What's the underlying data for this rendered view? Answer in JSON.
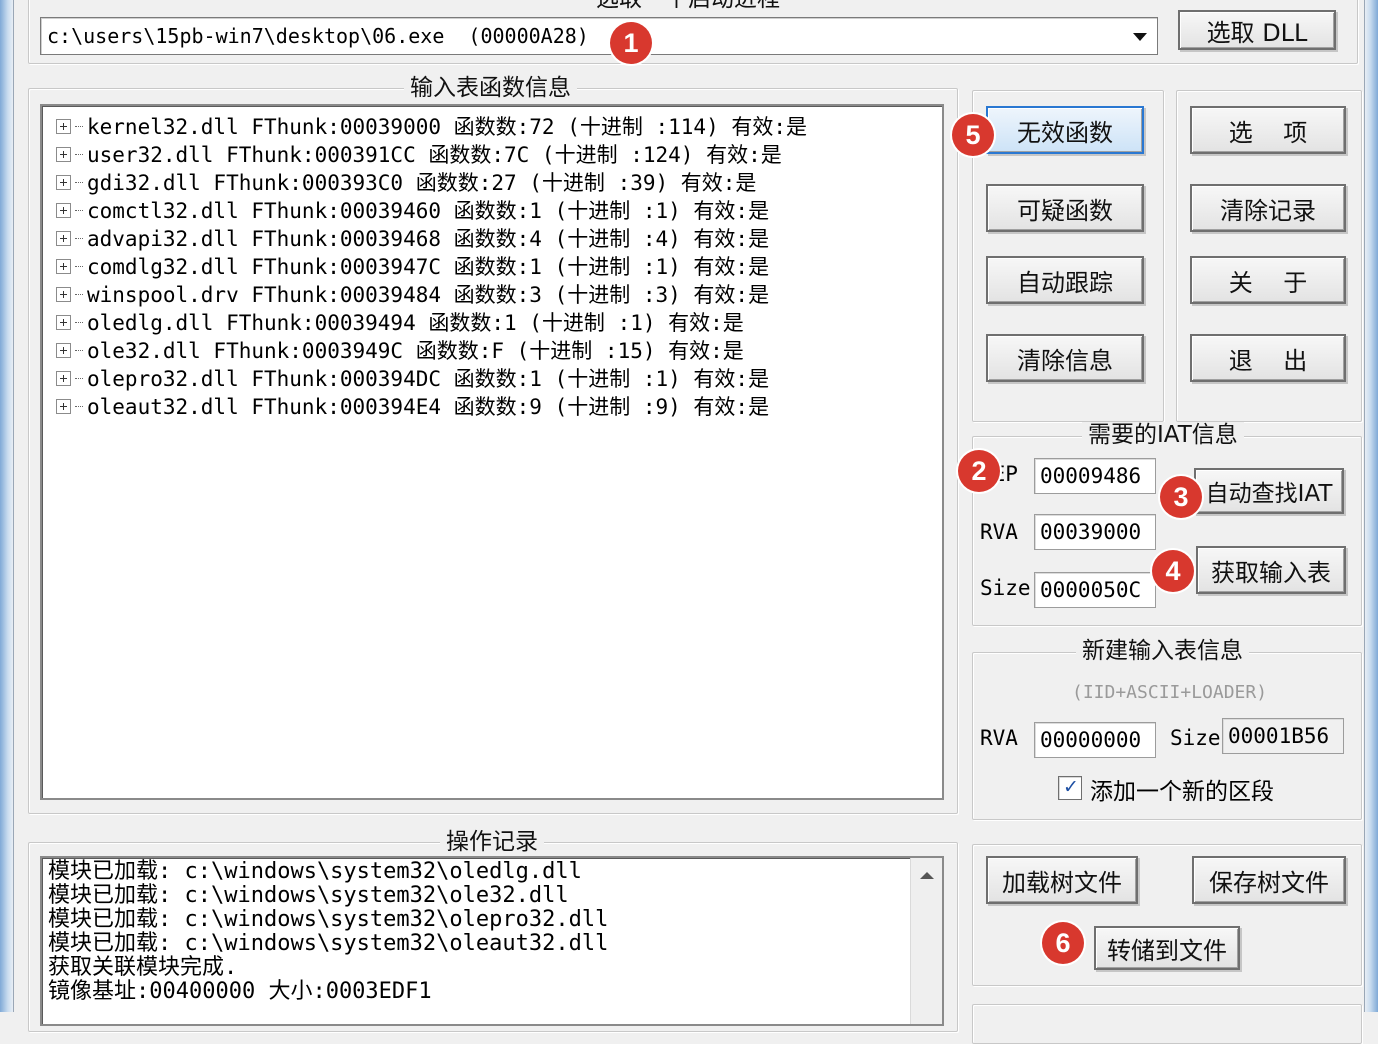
{
  "process_group": {
    "title": "选取一个启动进程",
    "selected_process": "c:\\users\\15pb-win7\\desktop\\06.exe  (00000A28)",
    "select_dll_label": "选取 DLL"
  },
  "import_group": {
    "title": "输入表函数信息",
    "modules": [
      "kernel32.dll FThunk:00039000 函数数:72 (十进制 :114) 有效:是",
      "user32.dll FThunk:000391CC 函数数:7C (十进制 :124) 有效:是",
      "gdi32.dll FThunk:000393C0 函数数:27 (十进制 :39) 有效:是",
      "comctl32.dll FThunk:00039460 函数数:1 (十进制 :1) 有效:是",
      "advapi32.dll FThunk:00039468 函数数:4 (十进制 :4) 有效:是",
      "comdlg32.dll FThunk:0003947C 函数数:1 (十进制 :1) 有效:是",
      "winspool.drv FThunk:00039484 函数数:3 (十进制 :3) 有效:是",
      "oledlg.dll FThunk:00039494 函数数:1 (十进制 :1) 有效:是",
      "ole32.dll FThunk:0003949C 函数数:F (十进制 :15) 有效:是",
      "olepro32.dll FThunk:000394DC 函数数:1 (十进制 :1) 有效:是",
      "oleaut32.dll FThunk:000394E4 函数数:9 (十进制 :9) 有效:是"
    ]
  },
  "buttons_left": {
    "invalid": "无效函数",
    "suspect": "可疑函数",
    "auto_trace": "自动跟踪",
    "clear_info": "清除信息"
  },
  "buttons_right": {
    "options": "选    项",
    "clear_log": "清除记录",
    "about": "关    于",
    "exit": "退    出"
  },
  "iat_group": {
    "title": "需要的IAT信息",
    "oep_label": "OEP",
    "oep_value": "00009486",
    "rva_label": "RVA",
    "rva_value": "00039000",
    "size_label": "Size",
    "size_value": "0000050C",
    "auto_find_label": "自动查找IAT",
    "get_imports_label": "获取输入表"
  },
  "new_import_group": {
    "title": "新建输入表信息",
    "subtitle": "(IID+ASCII+LOADER)",
    "rva_label": "RVA",
    "rva_value": "00000000",
    "size_label": "Size",
    "size_value": "00001B56",
    "add_section_label": "添加一个新的区段",
    "add_section_checked": true
  },
  "log_group": {
    "title": "操作记录",
    "lines": [
      "模块已加载: c:\\windows\\system32\\oledlg.dll",
      "模块已加载: c:\\windows\\system32\\ole32.dll",
      "模块已加载: c:\\windows\\system32\\olepro32.dll",
      "模块已加载: c:\\windows\\system32\\oleaut32.dll",
      "获取关联模块完成.",
      "镜像基址:00400000 大小:0003EDF1"
    ]
  },
  "tree_file_group": {
    "load_label": "加载树文件",
    "save_label": "保存树文件",
    "dump_label": "转储到文件"
  },
  "annotations": [
    "1",
    "2",
    "3",
    "4",
    "5",
    "6"
  ],
  "colors": {
    "badge": "#d8382e",
    "focus_border": "#2a78d2",
    "window_bg": "#f0f0f0"
  }
}
